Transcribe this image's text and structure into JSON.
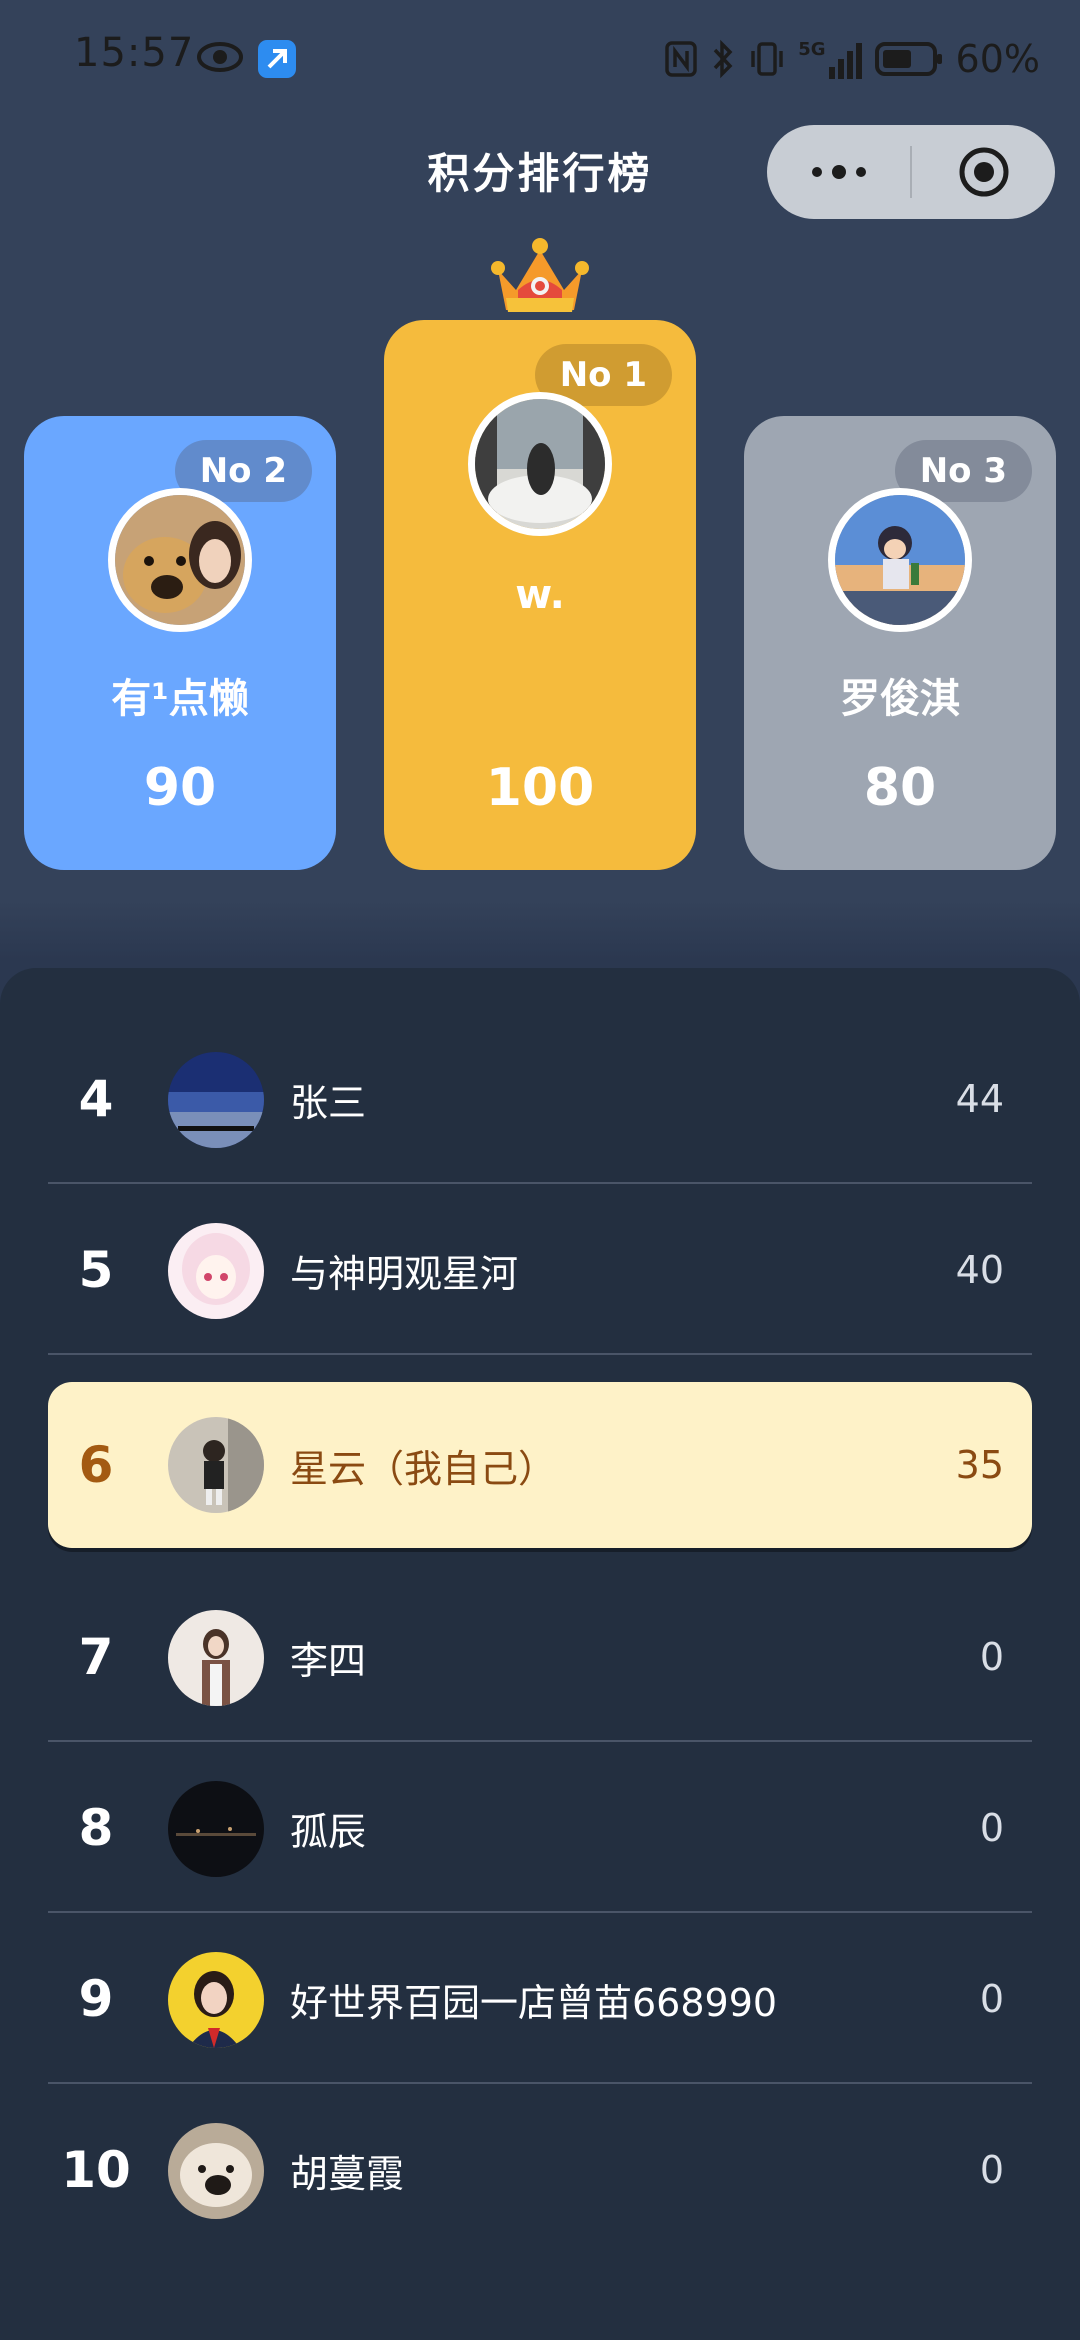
{
  "status_bar": {
    "time": "15:57",
    "signal_label": "5G",
    "battery_text": "60%",
    "icons": [
      "eye-icon",
      "app-notification-icon",
      "nfc-icon",
      "bluetooth-icon",
      "vibrate-icon",
      "signal-icon",
      "battery-icon"
    ]
  },
  "header": {
    "title": "积分排行榜",
    "more_icon": "more-dots-icon",
    "close_icon": "target-close-icon"
  },
  "podium": {
    "first": {
      "badge": "No 1",
      "name": "w.",
      "score": "100",
      "color": "#f5bb3d"
    },
    "second": {
      "badge": "No 2",
      "name": "有¹点懒",
      "score": "90",
      "color": "#6aa7ff"
    },
    "third": {
      "badge": "No 3",
      "name": "罗俊淇",
      "score": "80",
      "color": "#9ea6b2"
    }
  },
  "list": [
    {
      "rank": "4",
      "name": "张三",
      "score": "44"
    },
    {
      "rank": "5",
      "name": "与神明观星河",
      "score": "40"
    },
    {
      "rank": "6",
      "name": "星云（我自己）",
      "score": "35",
      "is_self": true
    },
    {
      "rank": "7",
      "name": "李四",
      "score": "0"
    },
    {
      "rank": "8",
      "name": "孤辰",
      "score": "0"
    },
    {
      "rank": "9",
      "name": "好世界百园一店曾苗668990",
      "score": "0"
    },
    {
      "rank": "10",
      "name": "胡蔓霞",
      "score": "0"
    }
  ],
  "colors": {
    "background": "#33415a",
    "list_panel": "#232f40",
    "self_highlight": "#fef2c8",
    "self_text": "#8a4a12"
  }
}
